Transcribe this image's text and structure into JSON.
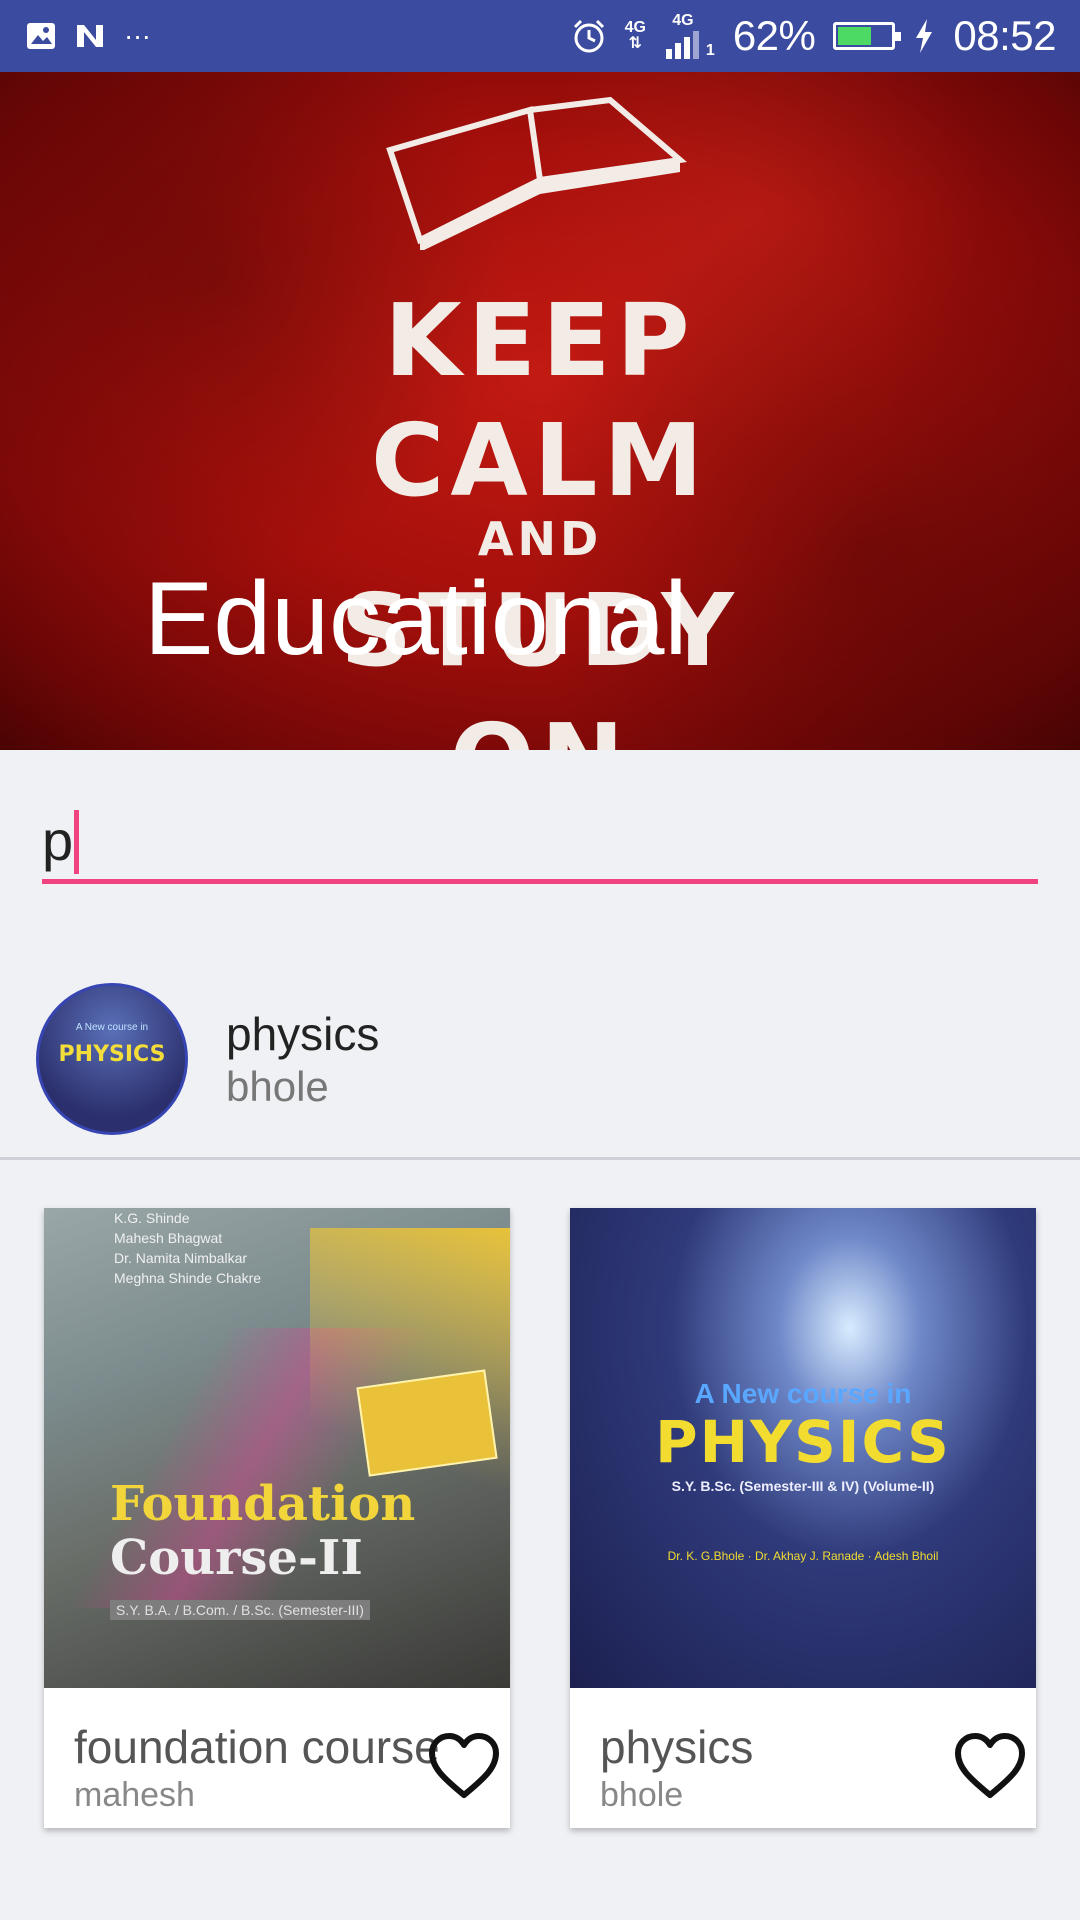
{
  "status_bar": {
    "icons_left": [
      "image-icon",
      "n-icon",
      "more-icon"
    ],
    "more_text": "···",
    "network": "4G",
    "network2": "4G",
    "sim_index": "1",
    "battery": "62%",
    "battery_level": 0.62,
    "time": "08:52"
  },
  "banner": {
    "title": "Educational",
    "poster_lines": [
      "KEEP",
      "CALM",
      "AND",
      "STUDY",
      "ON"
    ],
    "background_color": "#b3120d"
  },
  "search": {
    "value": "p",
    "accent": "#f0437f"
  },
  "result": {
    "title": "physics",
    "subtitle": "bhole",
    "avatar_cover_title": "PHYSICS",
    "avatar_cover_sub": "A New course in"
  },
  "cards": [
    {
      "title": "foundation course",
      "subtitle": "mahesh",
      "cover": {
        "authors": [
          "K.G. Shinde",
          "Mahesh Bhagwat",
          "Dr. Namita Nimbalkar",
          "Meghna Shinde Chakre"
        ],
        "title1": "Foundation",
        "title2": "Course-II",
        "tag": "S.Y. B.A. / B.Com. / B.Sc. (Semester-III)"
      }
    },
    {
      "title": "physics",
      "subtitle": "bhole",
      "cover": {
        "title1": "A New course in",
        "title2": "PHYSICS",
        "tag": "S.Y. B.Sc. (Semester-III & IV) (Volume-II)",
        "authors": "Dr. K. G.Bhole · Dr. Akhay J. Ranade · Adesh Bhoil"
      }
    }
  ]
}
